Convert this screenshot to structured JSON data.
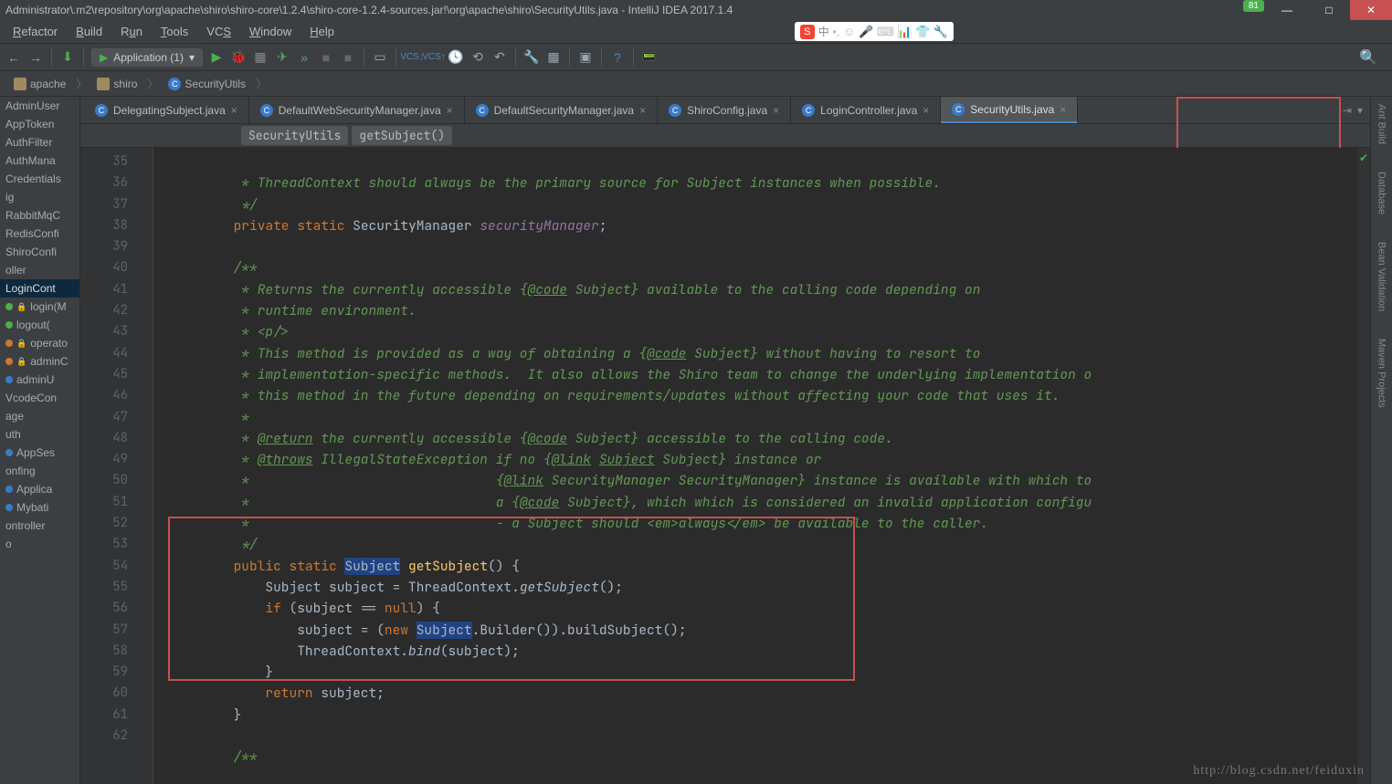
{
  "title": "Administrator\\.m2\\repository\\org\\apache\\shiro\\shiro-core\\1.2.4\\shiro-core-1.2.4-sources.jar!\\org\\apache\\shiro\\SecurityUtils.java - IntelliJ IDEA 2017.1.4",
  "badge360": "81",
  "menu": {
    "refactor": "Refactor",
    "build": "Build",
    "run": "Run",
    "tools": "Tools",
    "vcs": "VCS",
    "window": "Window",
    "help": "Help"
  },
  "ime": {
    "logo": "S",
    "char": "中"
  },
  "runConfig": "Application (1)",
  "breadcrumb": {
    "apache": "apache",
    "shiro": "shiro",
    "cls": "SecurityUtils"
  },
  "structure": {
    "items": [
      {
        "label": "AdminUser"
      },
      {
        "label": "AppToken"
      },
      {
        "label": "AuthFilter"
      },
      {
        "label": "AuthMana"
      },
      {
        "label": "Credentials"
      },
      {
        "label": "ig"
      },
      {
        "label": "RabbitMqC"
      },
      {
        "label": "RedisConfi"
      },
      {
        "label": "ShiroConfi"
      },
      {
        "label": "oller"
      },
      {
        "label": "LoginCont",
        "sel": true
      },
      {
        "label": "login(M",
        "dot": "g",
        "lock": true
      },
      {
        "label": "logout(",
        "dot": "g"
      },
      {
        "label": "operato",
        "dot": "o",
        "lock": true
      },
      {
        "label": "adminC",
        "dot": "o",
        "lock": true
      },
      {
        "label": "adminU",
        "dot": "b"
      },
      {
        "label": "VcodeCon"
      },
      {
        "label": "age"
      },
      {
        "label": "uth"
      },
      {
        "label": "AppSes",
        "dot": "b"
      },
      {
        "label": "onfing"
      },
      {
        "label": "Applica",
        "dot": "b"
      },
      {
        "label": "Mybati",
        "dot": "b"
      },
      {
        "label": "ontroller"
      },
      {
        "label": "o"
      }
    ]
  },
  "tabs": [
    {
      "label": "DelegatingSubject.java"
    },
    {
      "label": "DefaultWebSecurityManager.java"
    },
    {
      "label": "DefaultSecurityManager.java"
    },
    {
      "label": "ShiroConfig.java"
    },
    {
      "label": "LoginController.java"
    },
    {
      "label": "SecurityUtils.java",
      "active": true
    }
  ],
  "methodCrumb": {
    "cls": "SecurityUtils",
    "mth": "getSubject()"
  },
  "lines": {
    "start": 35,
    "end": 61
  },
  "code": {
    "l35": "         * ThreadContext should always be the primary source for Subject instances when possible.",
    "l36": "         */",
    "l37a": "private",
    "l37b": "static",
    "l37c": "SecurityManager",
    "l37d": "securityManager",
    "l37e": ";",
    "l39": "        /**",
    "l40a": "         * Returns the currently accessible {",
    "l40b": "@code",
    "l40c": " Subject} available to the calling code depending on",
    "l41": "         * runtime environment.",
    "l42": "         * <p/>",
    "l43a": "         * This method is provided as a way of obtaining a {",
    "l43b": "@code",
    "l43c": " Subject} without having to resort to",
    "l44": "         * implementation-specific methods.  It also allows the Shiro team to change the underlying implementation o",
    "l45": "         * this method in the future depending on requirements/updates without affecting your code that uses it.",
    "l46": "         *",
    "l47a": "         * ",
    "l47b": "@return",
    "l47c": " the currently accessible {",
    "l47d": "@code",
    "l47e": " Subject} accessible to the calling code.",
    "l48a": "         * ",
    "l48b": "@throws",
    "l48c": " IllegalStateException if no {",
    "l48d": "@link",
    "l48e": " ",
    "l48f": "Subject",
    "l48g": " Subject} instance or",
    "l49a": "         *                               {",
    "l49b": "@link",
    "l49c": " SecurityManager SecurityManager} instance is available with which to",
    "l50a": "         *                               a {",
    "l50b": "@code",
    "l50c": " Subject}, which which is considered an invalid application configu",
    "l51": "         *                               - a Subject should <em>always</em> be available to the caller.",
    "l52": "         */",
    "l53a": "public",
    "l53b": "static",
    "l53c": "Subject",
    "l53d": "getSubject",
    "l53e": "() {",
    "l54a": "Subject subject = ThreadContext.",
    "l54b": "getSubject",
    "l54c": "();",
    "l55a": "if",
    "l55b": " (subject == ",
    "l55c": "null",
    "l55d": ") {",
    "l56a": "subject = (",
    "l56b": "new",
    "l56c": " ",
    "l56d": "Subject",
    "l56e": ".Builder()).buildSubject();",
    "l57a": "ThreadContext.",
    "l57b": "bind",
    "l57c": "(subject);",
    "l58": "}",
    "l59a": "return",
    "l59b": " subject;",
    "l60": "}",
    "l62": "        /**"
  },
  "rightRail": {
    "ant": "Ant Build",
    "db": "Database",
    "bv": "Bean Validation",
    "mvn": "Maven Projects"
  },
  "watermark": "http://blog.csdn.net/feiduxin"
}
